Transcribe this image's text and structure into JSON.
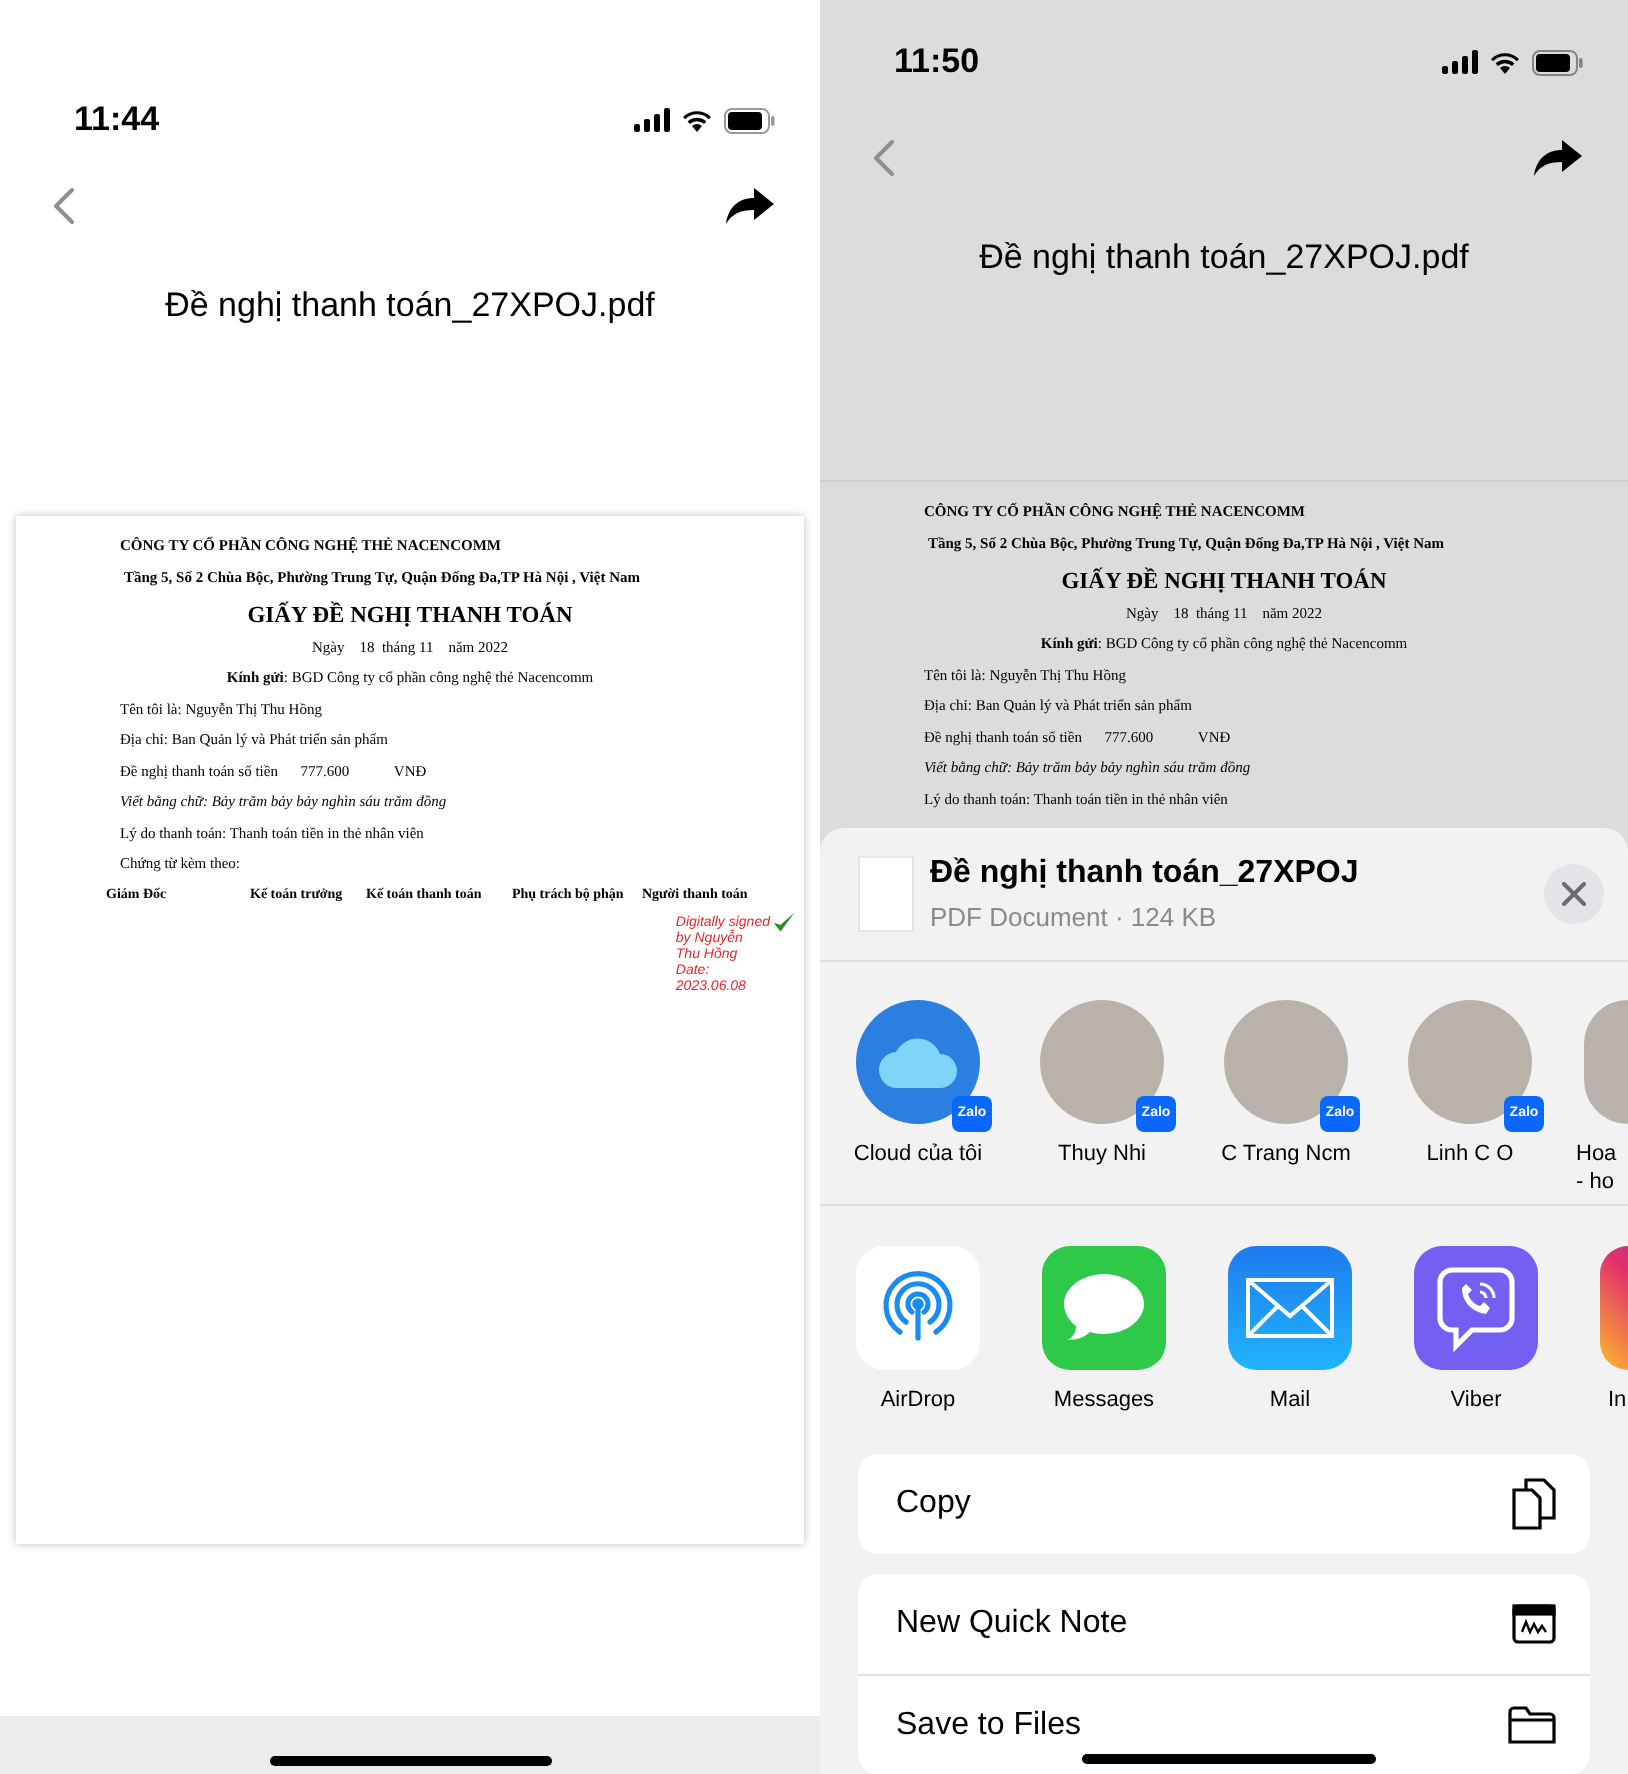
{
  "left_screen": {
    "status_bar": {
      "time": "11:44"
    },
    "title": "Đề nghị thanh toán_27XPOJ.pdf",
    "document": {
      "lines": [
        {
          "kind": "company",
          "text": "CÔNG TY CỔ PHẦN CÔNG NGHỆ THẺ NACENCOMM"
        },
        {
          "kind": "address",
          "text": "Tầng 5, Số 2 Chùa Bộc, Phường Trung Tự, Quận Đống Đa,TP Hà Nội , Việt Nam"
        },
        {
          "kind": "heading",
          "text": "GIẤY ĐỀ NGHỊ THANH TOÁN"
        },
        {
          "kind": "date",
          "text": "Ngày    18  tháng 11    năm 2022"
        },
        {
          "kind": "recipient",
          "text": "**Kính gửi**: BGD Công ty cổ phần công nghệ thẻ Nacencomm"
        },
        {
          "kind": "plain",
          "text": "Tên tôi là: Nguyễn Thị Thu Hồng"
        },
        {
          "kind": "plain",
          "text": "Địa chỉ: Ban Quản lý và Phát triển sản phẩm"
        },
        {
          "kind": "plain",
          "text": "Đề nghị thanh toán số tiền      777.600            VNĐ"
        },
        {
          "kind": "italic",
          "text": "Viết bằng chữ: Bảy trăm bảy bảy nghìn sáu trăm đồng"
        },
        {
          "kind": "plain",
          "text": "Lý do thanh toán: Thanh toán tiền in thẻ nhân viên"
        },
        {
          "kind": "plain",
          "text": "Chứng từ kèm theo:"
        }
      ],
      "signatories": [
        "Giám Đốc",
        "Kế toán trưởng",
        "Kế toán thanh toán",
        "Phụ trách bộ phận",
        "Người thanh toán"
      ],
      "signature_stamp": [
        "Digitally signed",
        "by Nguyễn",
        "Thu Hồng",
        "Date:",
        "2023.06.08"
      ]
    }
  },
  "right_screen": {
    "status_bar": {
      "time": "11:50"
    },
    "title": "Đề nghị thanh toán_27XPOJ.pdf",
    "document": {
      "lines": [
        {
          "kind": "company",
          "text": "CÔNG TY CỔ PHẦN CÔNG NGHỆ THẺ NACENCOMM"
        },
        {
          "kind": "address",
          "text": "Tầng 5, Số 2 Chùa Bộc, Phường Trung Tự, Quận Đống Đa,TP Hà Nội , Việt Nam"
        },
        {
          "kind": "heading",
          "text": "GIẤY ĐỀ NGHỊ THANH TOÁN"
        },
        {
          "kind": "date",
          "text": "Ngày    18  tháng 11    năm 2022"
        },
        {
          "kind": "recipient",
          "text": "**Kính gửi**: BGD Công ty cổ phần công nghệ thẻ Nacencomm"
        },
        {
          "kind": "plain",
          "text": "Tên tôi là: Nguyễn Thị Thu Hồng"
        },
        {
          "kind": "plain",
          "text": "Địa chỉ: Ban Quản lý và Phát triển sản phẩm"
        },
        {
          "kind": "plain",
          "text": "Đề nghị thanh toán số tiền      777.600            VNĐ"
        },
        {
          "kind": "italic",
          "text": "Viết bằng chữ: Bảy trăm bảy bảy nghìn sáu trăm đồng"
        },
        {
          "kind": "plain",
          "text": "Lý do thanh toán: Thanh toán tiền in thẻ nhân viên"
        }
      ]
    },
    "share_sheet": {
      "file_name": "Đề nghị thanh toán_27XPOJ",
      "file_info": "PDF Document · 124 KB",
      "contacts": [
        {
          "kind": "cloud",
          "name": "Cloud của tôi",
          "badge": "Zalo"
        },
        {
          "kind": "person",
          "name": "Thuy Nhi",
          "badge": "Zalo"
        },
        {
          "kind": "person",
          "name": "C Trang Ncm",
          "badge": "Zalo"
        },
        {
          "kind": "person",
          "name": "Linh C O",
          "badge": "Zalo"
        },
        {
          "kind": "person",
          "name": "Hoa - ho"
        }
      ],
      "apps": [
        {
          "kind": "airdrop",
          "name": "AirDrop"
        },
        {
          "kind": "messages",
          "name": "Messages"
        },
        {
          "kind": "mail",
          "name": "Mail"
        },
        {
          "kind": "viber",
          "name": "Viber"
        },
        {
          "kind": "instagram",
          "name": "In"
        }
      ],
      "actions": [
        {
          "kind": "copy",
          "label": "Copy"
        },
        {
          "kind": "note",
          "label": "New Quick Note"
        },
        {
          "kind": "folder",
          "label": "Save to Files"
        }
      ]
    }
  }
}
